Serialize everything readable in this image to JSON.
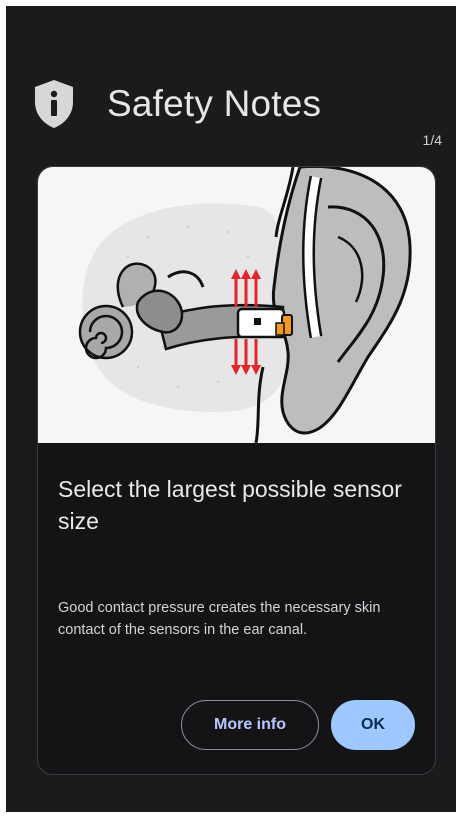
{
  "header": {
    "title": "Safety Notes",
    "icon": "shield-info-icon",
    "pager": "1/4"
  },
  "card": {
    "illustration": "ear-sensor-illustration",
    "title": "Select the largest possible sensor size",
    "body": "Good contact pressure creates the necessary skin contact of the sensors in the ear canal.",
    "buttons": {
      "more_info": "More info",
      "ok": "OK"
    }
  },
  "colors": {
    "background": "#1b1b1d",
    "card": "#141417",
    "accent": "#9ec8ff",
    "arrows": "#e0262b",
    "sensor_tip": "#f29a1f"
  }
}
